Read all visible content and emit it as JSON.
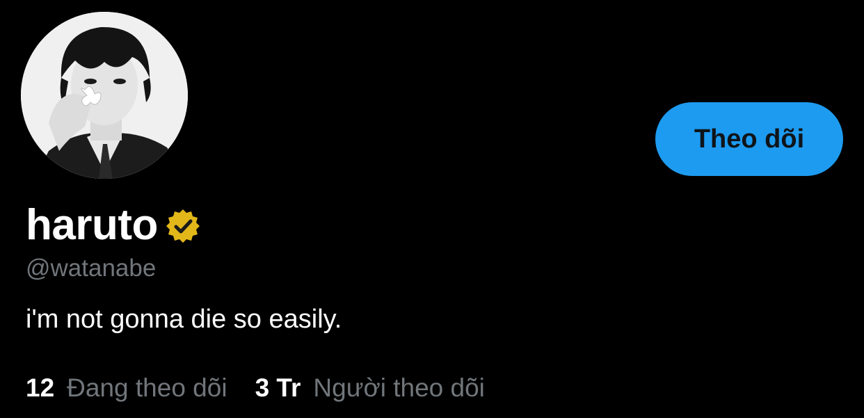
{
  "profile": {
    "display_name": "haruto",
    "handle": "@watanabe",
    "bio": "i'm not gonna die so easily.",
    "verified_badge_icon": "verified-gold-badge",
    "avatar_description": "black-and-white portrait photo"
  },
  "actions": {
    "follow_label": "Theo dõi"
  },
  "stats": {
    "following_count": "12",
    "following_label": "Đang theo dõi",
    "followers_count": "3 Tr",
    "followers_label": "Người theo dõi"
  },
  "colors": {
    "background": "#000000",
    "accent": "#1d9bf0",
    "muted_text": "#71767b",
    "badge_gold": "#e2b719"
  }
}
